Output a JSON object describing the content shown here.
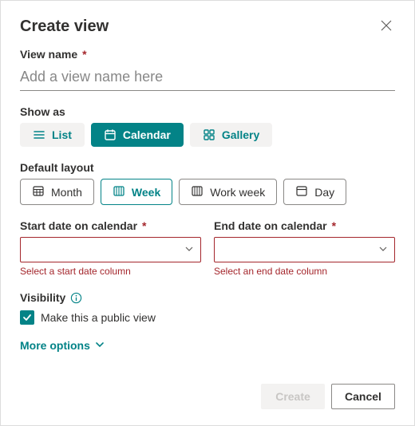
{
  "dialog": {
    "title": "Create view"
  },
  "viewName": {
    "label": "View name",
    "placeholder": "Add a view name here",
    "value": ""
  },
  "showAs": {
    "label": "Show as",
    "options": {
      "list": "List",
      "calendar": "Calendar",
      "gallery": "Gallery"
    },
    "selected": "calendar"
  },
  "defaultLayout": {
    "label": "Default layout",
    "options": {
      "month": "Month",
      "week": "Week",
      "workweek": "Work week",
      "day": "Day"
    },
    "selected": "week"
  },
  "startDate": {
    "label": "Start date on calendar",
    "value": "",
    "error": "Select a start date column"
  },
  "endDate": {
    "label": "End date on calendar",
    "value": "",
    "error": "Select an end date column"
  },
  "visibility": {
    "label": "Visibility",
    "checkboxLabel": "Make this a public view",
    "checked": true
  },
  "moreOptions": {
    "label": "More options"
  },
  "footer": {
    "create": "Create",
    "cancel": "Cancel"
  }
}
